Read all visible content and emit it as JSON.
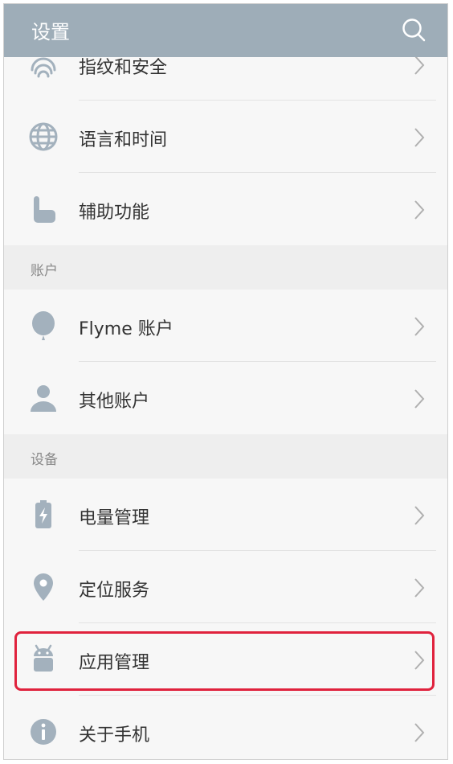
{
  "header": {
    "title": "设置"
  },
  "items_top": [
    {
      "label": "指纹和安全",
      "icon": "fingerprint-icon"
    },
    {
      "label": "语言和时间",
      "icon": "globe-icon"
    },
    {
      "label": "辅助功能",
      "icon": "hand-icon"
    }
  ],
  "section_account": {
    "title": "账户"
  },
  "items_account": [
    {
      "label": "Flyme 账户",
      "icon": "flyme-balloon-icon"
    },
    {
      "label": "其他账户",
      "icon": "person-icon"
    }
  ],
  "section_device": {
    "title": "设备"
  },
  "items_device": [
    {
      "label": "电量管理",
      "icon": "battery-icon"
    },
    {
      "label": "定位服务",
      "icon": "location-pin-icon"
    },
    {
      "label": "应用管理",
      "icon": "android-icon"
    },
    {
      "label": "关于手机",
      "icon": "info-icon"
    }
  ],
  "colors": {
    "header": "#9eadb8",
    "icon": "#a3b1bd",
    "highlight": "#e0223d"
  }
}
